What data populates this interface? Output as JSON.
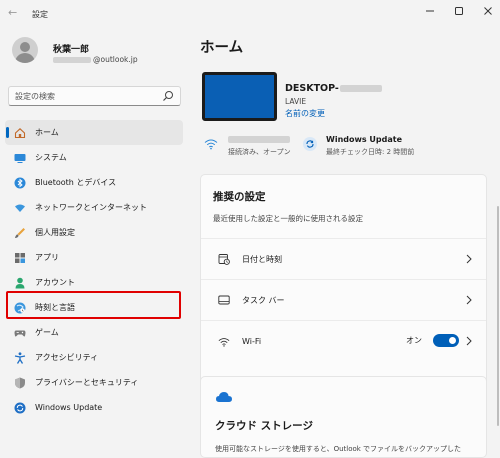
{
  "window": {
    "title": "設定"
  },
  "user": {
    "name": "秋葉一郎",
    "email_suffix": "@outlook.jp"
  },
  "search": {
    "placeholder": "設定の検索"
  },
  "nav": [
    {
      "label": "ホーム",
      "icon": "home-icon",
      "active": true
    },
    {
      "label": "システム",
      "icon": "system-icon"
    },
    {
      "label": "Bluetooth とデバイス",
      "icon": "bluetooth-icon"
    },
    {
      "label": "ネットワークとインターネット",
      "icon": "network-icon"
    },
    {
      "label": "個人用設定",
      "icon": "personalization-icon"
    },
    {
      "label": "アプリ",
      "icon": "apps-icon"
    },
    {
      "label": "アカウント",
      "icon": "accounts-icon"
    },
    {
      "label": "時刻と言語",
      "icon": "time-language-icon",
      "highlighted": true
    },
    {
      "label": "ゲーム",
      "icon": "gaming-icon"
    },
    {
      "label": "アクセシビリティ",
      "icon": "accessibility-icon"
    },
    {
      "label": "プライバシーとセキュリティ",
      "icon": "privacy-icon"
    },
    {
      "label": "Windows Update",
      "icon": "windows-update-icon"
    }
  ],
  "main": {
    "title": "ホーム",
    "device": {
      "name_prefix": "DESKTOP-",
      "model": "LAVIE",
      "rename_link": "名前の変更"
    },
    "network_status": {
      "subtitle": "接続済み、オープン"
    },
    "windows_update": {
      "title": "Windows Update",
      "subtitle": "最終チェック日時: 2 時間前"
    },
    "recommended": {
      "title": "推奨の設定",
      "subtitle": "最近使用した設定と一般的に使用される設定",
      "rows": [
        {
          "label": "日付と時刻",
          "icon": "calendar-clock-icon"
        },
        {
          "label": "タスク バー",
          "icon": "taskbar-icon"
        },
        {
          "label": "Wi-Fi",
          "icon": "wifi-icon",
          "toggle_label": "オン",
          "toggle_on": true
        }
      ]
    },
    "cloud": {
      "title": "クラウド ストレージ",
      "subtitle": "使用可能なストレージを使用すると、Outlook でファイルをバックアップした"
    }
  },
  "colors": {
    "accent": "#005fb8",
    "highlight": "#e00000",
    "device_screen": "#0a5fb4"
  }
}
